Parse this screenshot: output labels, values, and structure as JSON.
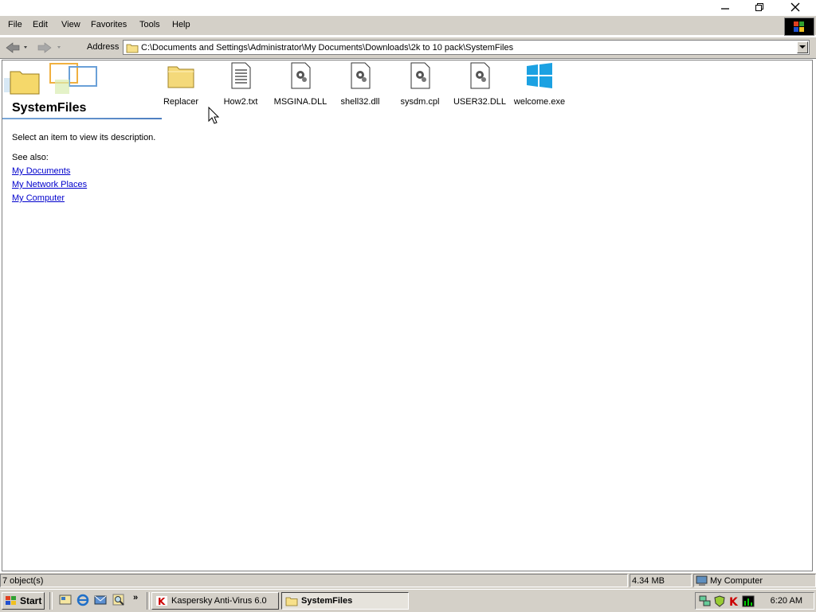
{
  "menu": [
    "File",
    "Edit",
    "View",
    "Favorites",
    "Tools",
    "Help"
  ],
  "address": {
    "label": "Address",
    "path": "C:\\Documents and Settings\\Administrator\\My Documents\\Downloads\\2k to 10 pack\\SystemFiles"
  },
  "panel": {
    "title": "SystemFiles",
    "description": "Select an item to view its description.",
    "see_also_label": "See also:",
    "links": [
      "My Documents",
      "My Network Places",
      "My Computer"
    ]
  },
  "files": [
    {
      "name": "Replacer",
      "icon": "folder-icon"
    },
    {
      "name": "How2.txt",
      "icon": "text-file-icon"
    },
    {
      "name": "MSGINA.DLL",
      "icon": "dll-file-icon"
    },
    {
      "name": "shell32.dll",
      "icon": "dll-file-icon"
    },
    {
      "name": "sysdm.cpl",
      "icon": "cpl-file-icon"
    },
    {
      "name": "USER32.DLL",
      "icon": "dll-file-icon"
    },
    {
      "name": "welcome.exe",
      "icon": "windows-logo-icon"
    }
  ],
  "status": {
    "objects": "7 object(s)",
    "size": "4.34 MB",
    "zone": "My Computer"
  },
  "taskbar": {
    "start": "Start",
    "tasks": [
      "Kaspersky Anti-Virus 6.0",
      "SystemFiles"
    ],
    "clock": "6:20 AM"
  },
  "colors": {
    "link": "#0000cc",
    "chrome": "#d4d0c8",
    "windows_logo": "#1ba1e2",
    "kaspersky": "#cc0000"
  }
}
